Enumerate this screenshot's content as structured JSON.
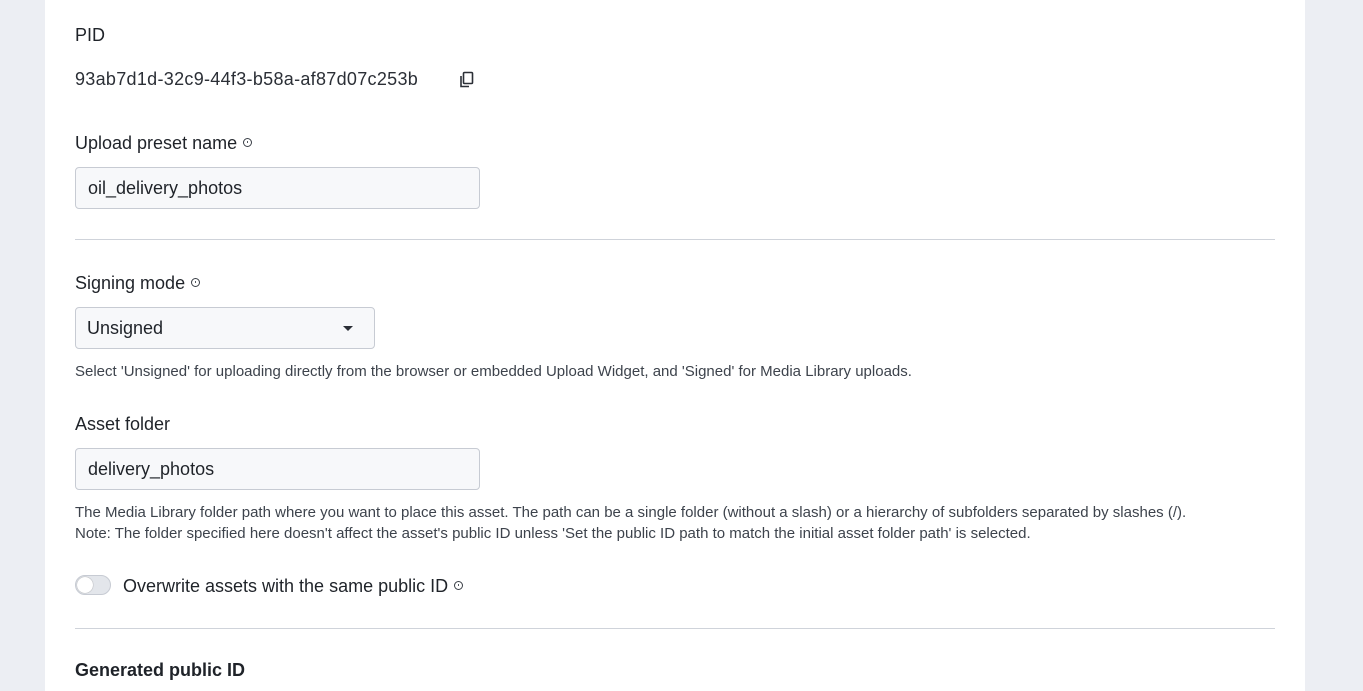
{
  "pid": {
    "label": "PID",
    "value": "93ab7d1d-32c9-44f3-b58a-af87d07c253b",
    "copy_icon": "copy-icon"
  },
  "upload_preset": {
    "label": "Upload preset name",
    "value": "oil_delivery_photos"
  },
  "signing_mode": {
    "label": "Signing mode",
    "selected": "Unsigned",
    "help": "Select 'Unsigned' for uploading directly from the browser or embedded Upload Widget, and 'Signed' for Media Library uploads."
  },
  "asset_folder": {
    "label": "Asset folder",
    "value": "delivery_photos",
    "help_line1": "The Media Library folder path where you want to place this asset. The path can be a single folder (without a slash) or a hierarchy of subfolders separated by slashes (/).",
    "help_line2": "Note: The folder specified here doesn't affect the asset's public ID unless 'Set the public ID path to match the initial asset folder path' is selected."
  },
  "overwrite": {
    "label": "Overwrite assets with the same public ID",
    "enabled": false
  },
  "generated_public_id": {
    "title": "Generated public ID"
  }
}
